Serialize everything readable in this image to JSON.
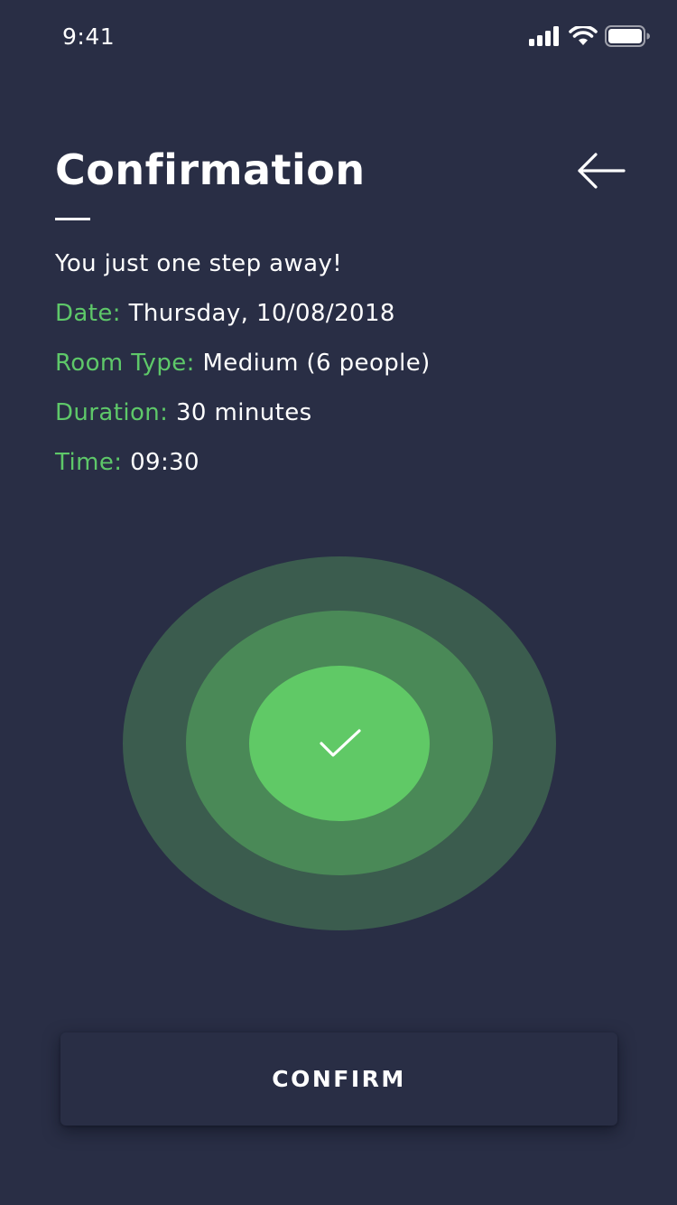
{
  "status_bar": {
    "time": "9:41",
    "icons": [
      "cellular-signal-icon",
      "wifi-icon",
      "battery-icon"
    ]
  },
  "header": {
    "title": "Confirmation",
    "back_icon": "arrow-left-icon"
  },
  "details": {
    "subtitle": "You just one step away!",
    "rows": [
      {
        "label": "Date:",
        "value": "Thursday, 10/08/2018"
      },
      {
        "label": "Room Type:",
        "value": "Medium (6 people)"
      },
      {
        "label": "Duration:",
        "value": "30 minutes"
      },
      {
        "label": "Time:",
        "value": "09:30"
      }
    ]
  },
  "success": {
    "icon": "checkmark-icon"
  },
  "actions": {
    "confirm_label": "CONFIRM"
  },
  "colors": {
    "background": "#292e45",
    "accent_green": "#5ec869",
    "ring_outer": "#3b5c4e",
    "ring_middle": "#4a8957",
    "ring_inner": "#60c966",
    "text": "#ffffff"
  }
}
